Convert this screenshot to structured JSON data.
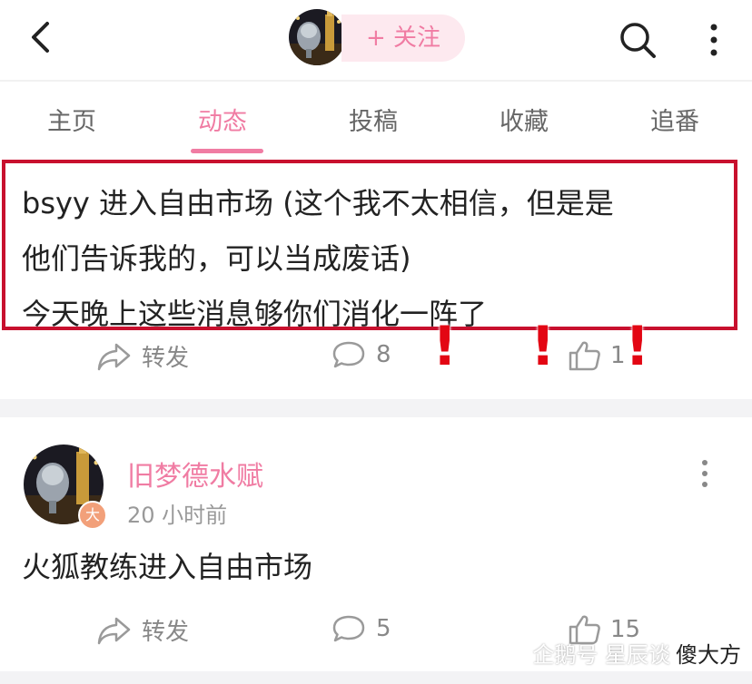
{
  "header": {
    "follow_label": "+ 关注"
  },
  "tabs": [
    {
      "label": "主页"
    },
    {
      "label": "动态"
    },
    {
      "label": "投稿"
    },
    {
      "label": "收藏"
    },
    {
      "label": "追番"
    }
  ],
  "active_tab": "动态",
  "colors": {
    "accent": "#f07ca3",
    "highlight_border": "#c8102e",
    "exclamation": "#e30613"
  },
  "post1": {
    "lines": [
      "bsyy 进入自由市场 (这个我不太相信，但是是",
      "他们告诉我的，可以当成废话)",
      "今天晚上这些消息够你们消化一阵了"
    ],
    "share_label": "转发",
    "comment_count": "8",
    "like_count": "1",
    "exclamations": [
      "!",
      "!",
      "!"
    ]
  },
  "post2": {
    "author": "旧梦德水赋",
    "badge": "大",
    "time": "20 小时前",
    "text": "火狐教练进入自由市场",
    "share_label": "转发",
    "comment_count": "5",
    "like_count": "15"
  },
  "watermark": {
    "text": "企鹅号 星辰谈",
    "overlay": "傻大方"
  },
  "icons": [
    "back-icon",
    "search-icon",
    "more-icon",
    "share-icon",
    "comment-icon",
    "like-icon"
  ]
}
